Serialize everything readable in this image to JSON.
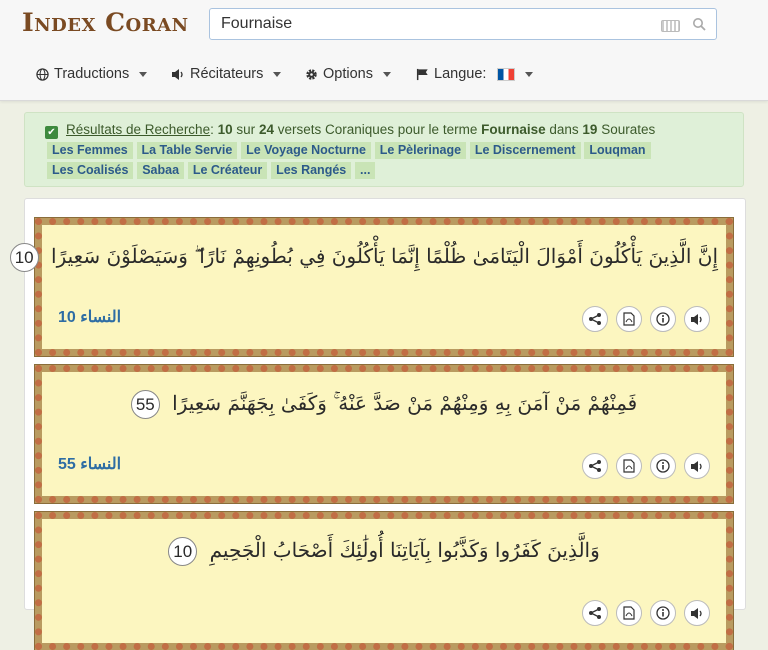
{
  "header": {
    "logo": "Index Coran",
    "search": {
      "value": "Fournaise",
      "placeholder": ""
    },
    "menus": [
      {
        "label": "Traductions",
        "icon": "globe-icon"
      },
      {
        "label": "Récitateurs",
        "icon": "speaker-icon"
      },
      {
        "label": "Options",
        "icon": "gear-icon"
      },
      {
        "label": "Langue:",
        "icon": "flag-icon"
      }
    ]
  },
  "results": {
    "link": "Résultats de Recherche",
    "colon": ":",
    "count": "10",
    "sur": "sur",
    "total": "24",
    "text_mid": "versets Coraniques pour le terme",
    "term": "Fournaise",
    "dans": "dans",
    "surah_count": "19",
    "sourates": "Sourates",
    "tags": [
      "Les Femmes",
      "La Table Servie",
      "Le Voyage Nocturne",
      "Le Pèlerinage",
      "Le Discernement",
      "Louqman",
      "Les Coalisés",
      "Sabaa",
      "Le Créateur",
      "Les Rangés",
      "..."
    ]
  },
  "verses": [
    {
      "text": "إِنَّ الَّذِينَ يَأْكُلُونَ أَمْوَالَ الْيَتَامَىٰ ظُلْمًا إِنَّمَا يَأْكُلُونَ فِي بُطُونِهِمْ نَارًا ۖ وَسَيَصْلَوْنَ سَعِيرًا",
      "number": "10",
      "ref": "النساء 10"
    },
    {
      "text": "فَمِنْهُمْ مَنْ آمَنَ بِهِ وَمِنْهُمْ مَنْ صَدَّ عَنْهُ ۚ وَكَفَىٰ بِجَهَنَّمَ سَعِيرًا",
      "number": "55",
      "ref": "النساء 55"
    },
    {
      "text": "وَالَّذِينَ كَفَرُوا وَكَذَّبُوا بِآيَاتِنَا أُولَٰئِكَ أَصْحَابُ الْجَحِيمِ",
      "number": "10",
      "ref": ""
    }
  ]
}
